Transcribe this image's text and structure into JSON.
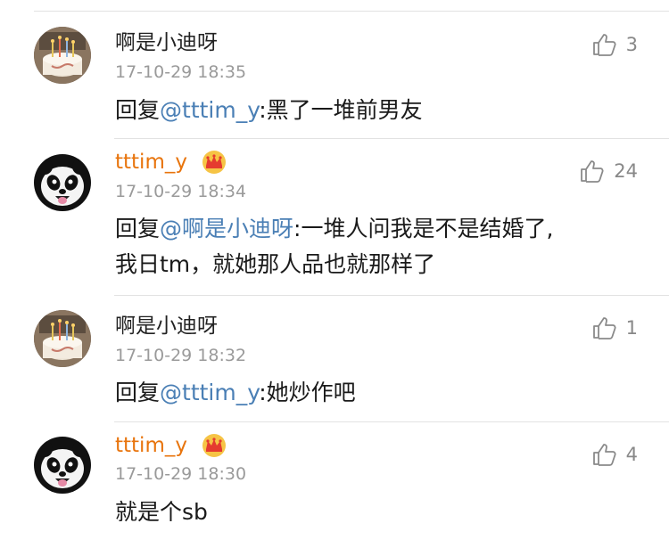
{
  "comments": [
    {
      "user": "啊是小迪呀",
      "vip": false,
      "time": "17-10-29 18:35",
      "reply_prefix": "回复",
      "mention": "@tttim_y",
      "text_lines": [
        ":黑了一堆前男友"
      ],
      "likes": "3",
      "avatar": "cake-avatar"
    },
    {
      "user": "tttim_y",
      "vip": true,
      "time": "17-10-29 18:34",
      "reply_prefix": "回复",
      "mention": "@啊是小迪呀",
      "text_lines": [
        ":一堆人问我是不是结婚了,",
        "我日tm，就她那人品也就那样了"
      ],
      "likes": "24",
      "avatar": "panda-avatar"
    },
    {
      "user": "啊是小迪呀",
      "vip": false,
      "time": "17-10-29 18:32",
      "reply_prefix": "回复",
      "mention": "@tttim_y",
      "text_lines": [
        ":她炒作吧"
      ],
      "likes": "1",
      "avatar": "cake-avatar"
    },
    {
      "user": "tttim_y",
      "vip": true,
      "time": "17-10-29 18:30",
      "reply_prefix": "",
      "mention": "",
      "text_lines": [
        "就是个sb"
      ],
      "likes": "4",
      "avatar": "panda-avatar"
    }
  ],
  "icons": {
    "like": "thumbs-up-icon",
    "vip": "crown-icon"
  },
  "colors": {
    "vip_name": "#e8740c",
    "mention": "#4a7fb5",
    "timestamp": "#9a9a9a",
    "divider": "#e2e2e2"
  }
}
